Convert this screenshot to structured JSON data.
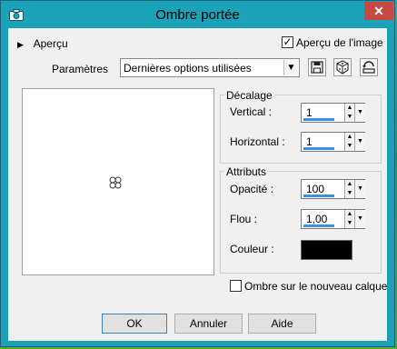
{
  "window": {
    "title": "Ombre portée",
    "close_label": "✕"
  },
  "preview_toggle": {
    "label": "Aperçu"
  },
  "preview_image": {
    "label": "Aperçu de l'image",
    "checked": true
  },
  "params": {
    "label": "Paramètres",
    "combo_value": "Dernières options utilisées"
  },
  "decalage": {
    "title": "Décalage",
    "vertical_label": "Vertical :",
    "vertical_value": "1",
    "horizontal_label": "Horizontal :",
    "horizontal_value": "1"
  },
  "attributs": {
    "title": "Attributs",
    "opacite_label": "Opacité :",
    "opacite_value": "100",
    "flou_label": "Flou :",
    "flou_value": "1,00",
    "couleur_label": "Couleur :",
    "couleur_hex": "#000000"
  },
  "new_layer": {
    "label": "Ombre sur le nouveau calque",
    "checked": false
  },
  "buttons": {
    "ok": "OK",
    "cancel": "Annuler",
    "help": "Aide"
  },
  "colors": {
    "titlebar": "#1ba2b8",
    "close": "#c74a42",
    "accent": "#3e8de0"
  }
}
